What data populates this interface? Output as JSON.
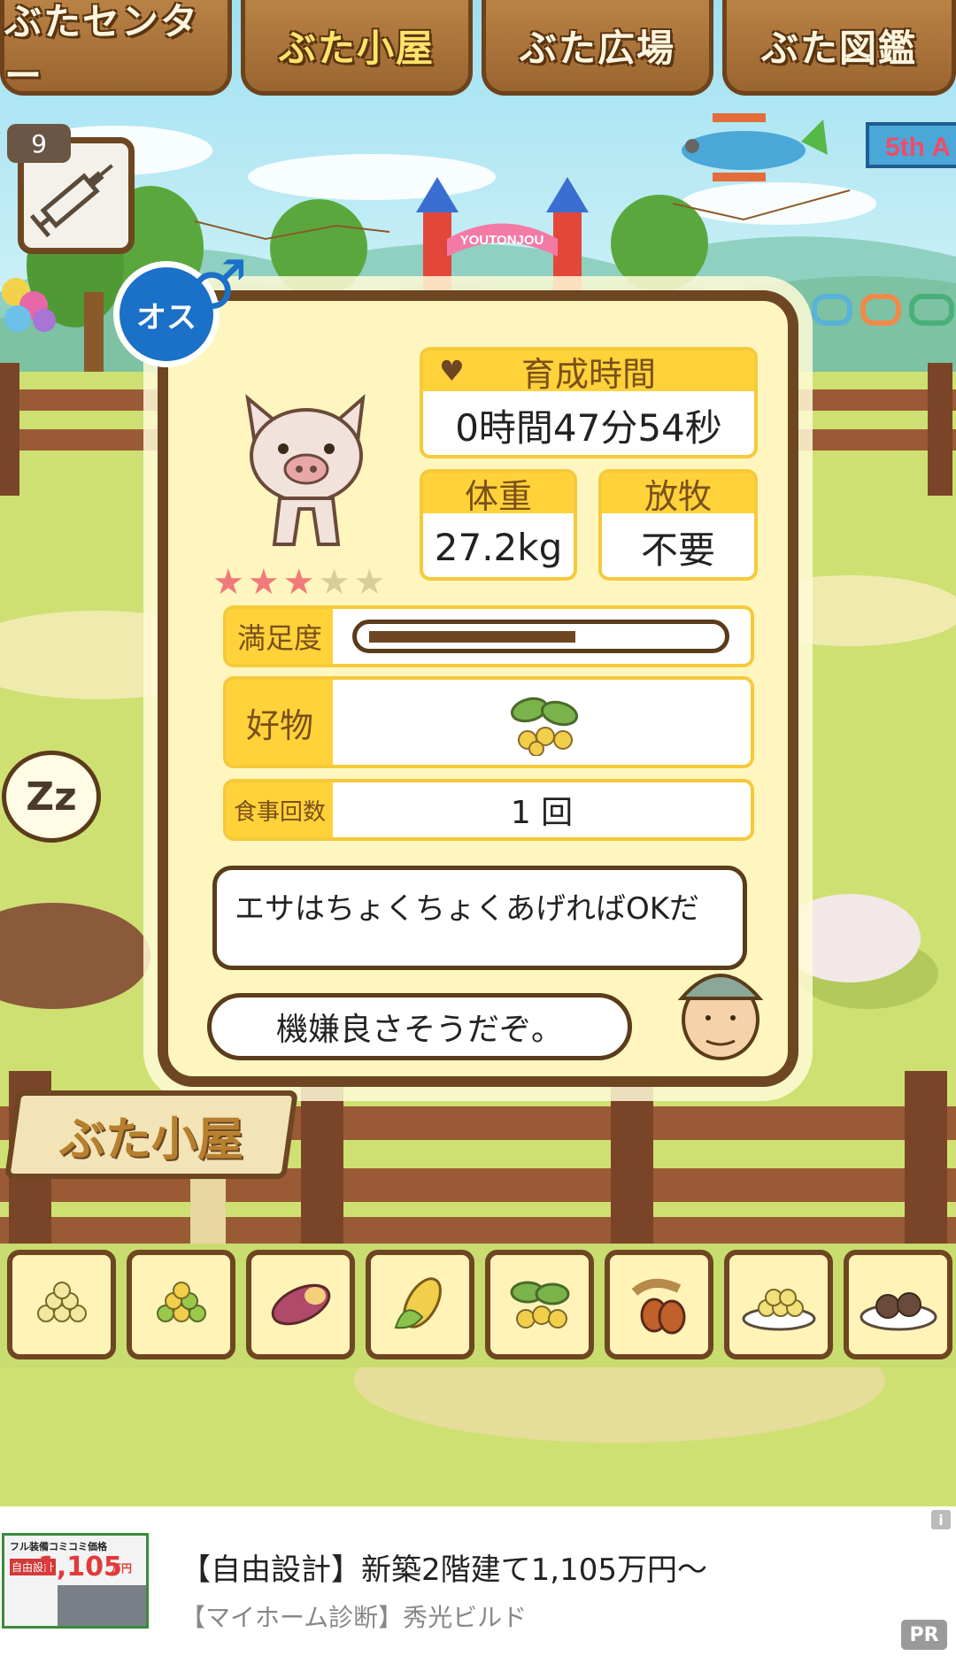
{
  "tabs": [
    "ぶたセンター",
    "ぶた小屋",
    "ぶた広場",
    "ぶた図鑑"
  ],
  "active_tab": 1,
  "syringe": {
    "count": "9",
    "icon": "syringe-icon"
  },
  "banner": {
    "text": "5th A",
    "gate_text": "YOUTONJOU"
  },
  "sleep_bubble": {
    "text": "Zz"
  },
  "pig": {
    "gender_label": "オス",
    "gender_icon": "male-symbol-icon",
    "rating": 3,
    "max_rating": 5,
    "growth_time_label": "育成時間",
    "growth_time_value": "0時間47分54秒",
    "weight_label": "体重",
    "weight_value": "27.2kg",
    "grazing_label": "放牧",
    "grazing_value": "不要",
    "satisfaction_label": "満足度",
    "satisfaction_level": 0.6,
    "favorite_label": "好物",
    "favorite_icon": "soybean-icon",
    "meals_label": "食事回数",
    "meals_value": "1 回",
    "farmer_tip": "エサはちょくちょくあげればOKだ",
    "mood_text": "機嫌良さそうだぞ。"
  },
  "sign": {
    "text": "ぶた小屋"
  },
  "food_items": [
    "feed-pellets-icon",
    "mixed-pellets-icon",
    "sweet-potato-icon",
    "corn-icon",
    "soybean-icon",
    "acorn-icon",
    "plate-pellets-icon",
    "plate-meatballs-icon"
  ],
  "colors": {
    "accent": "#ffd23a",
    "frame": "#6e4622",
    "card": "#fff6bf",
    "star_on": "#f07a7a",
    "star_off": "#d9cd9a"
  },
  "ad": {
    "thumb_line1": "フル装備コミコミ価格",
    "thumb_line2": "自由設計",
    "thumb_price": "1,105",
    "thumb_unit": "万円",
    "title": "【自由設計】新築2階建て1,105万円〜",
    "subtitle": "【マイホーム診断】秀光ビルド",
    "pr_label": "PR",
    "info_icon": "info-icon"
  }
}
